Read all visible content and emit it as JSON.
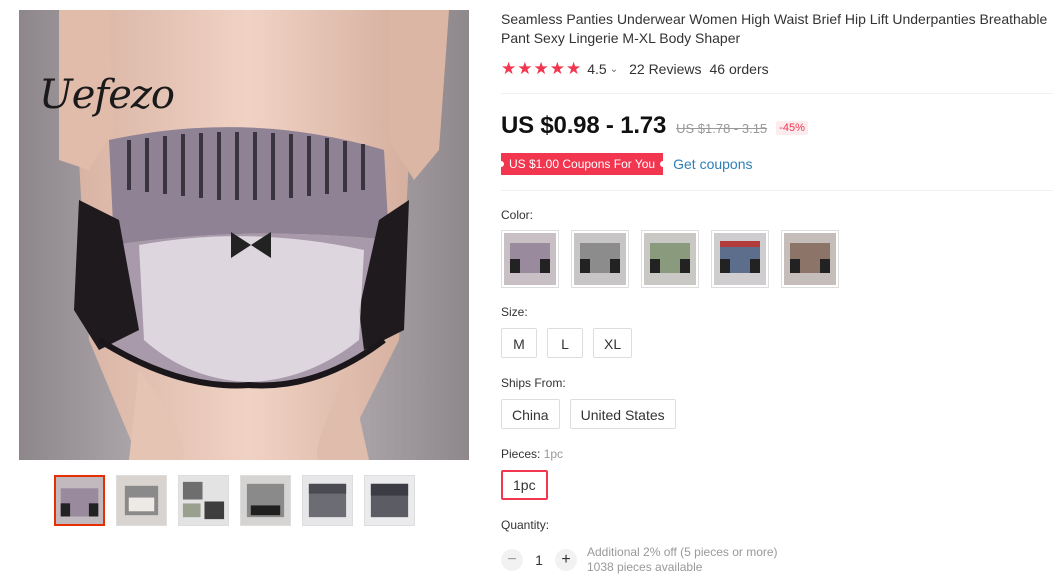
{
  "brand": {
    "logo_text": "Uefezo"
  },
  "product": {
    "title": "Seamless Panties Underwear Women High Waist Brief Hip Lift Underpanties Breathable Pant Sexy Lingerie M-XL Body Shaper",
    "rating": "4.5",
    "stars": 5,
    "reviews": "22 Reviews",
    "orders": "46 orders",
    "price": "US $0.98 - 1.73",
    "original_price": "US $1.78 - 3.15",
    "discount": "-45%",
    "coupon": "US $1.00 Coupons For You",
    "get_coupons": "Get coupons"
  },
  "color": {
    "label": "Color:",
    "swatches": [
      {
        "name": "purple-grey",
        "color": "#9a8a9e"
      },
      {
        "name": "grey",
        "color": "#8c8c8c"
      },
      {
        "name": "green",
        "color": "#8a9a7c"
      },
      {
        "name": "blue",
        "color": "#5c6e8c"
      },
      {
        "name": "brown",
        "color": "#8c7468"
      }
    ]
  },
  "size": {
    "label": "Size:",
    "options": [
      "M",
      "L",
      "XL"
    ]
  },
  "ships_from": {
    "label": "Ships From:",
    "options": [
      "China",
      "United States"
    ]
  },
  "pieces": {
    "label": "Pieces:",
    "selected_text": "1pc",
    "options": [
      "1pc"
    ]
  },
  "quantity": {
    "label": "Quantity:",
    "value": "1",
    "minus": "−",
    "plus": "+",
    "discount_note": "Additional 2% off (5 pieces or more)",
    "available": "1038 pieces available"
  },
  "thumbnails": {
    "count": 6,
    "active_index": 0,
    "colors": [
      "#9a8a9e",
      "#7a7a7a",
      "#6e6e6e",
      "#8a8a8a",
      "#6c6c74",
      "#5c5c64"
    ]
  },
  "icons": {
    "star": "star-icon",
    "chevron": "chevron-down-icon"
  }
}
